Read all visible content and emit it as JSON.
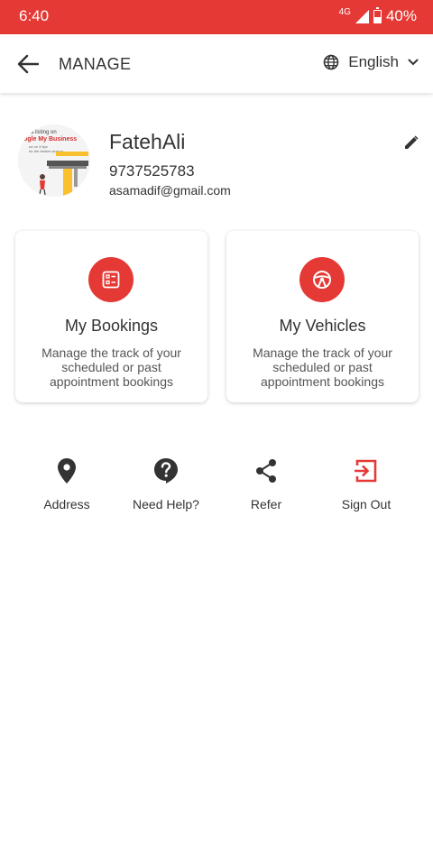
{
  "status_bar": {
    "time": "6:40",
    "network": "4G",
    "battery_percent": "40%",
    "battery_level": 0.4,
    "color": "#e53935"
  },
  "app_bar": {
    "back_icon": "arrow-left-icon",
    "title": "MANAGE",
    "language_icon": "globe-icon",
    "language": "English",
    "dropdown_icon": "chevron-down-icon"
  },
  "profile": {
    "name": "FatehAli",
    "phone": "9737525783",
    "email": "asamadif@gmail.com",
    "avatar_text": {
      "line1": "a listing on",
      "line2": "ogle My Business",
      "line3": "ue on 3 tips",
      "line4": "for the festive season"
    },
    "edit_icon": "pencil-icon"
  },
  "cards": [
    {
      "title": "My Bookings",
      "description": "Manage the track of your scheduled or past appointment bookings",
      "icon": "bookings-list-icon"
    },
    {
      "title": "My Vehicles",
      "description": "Manage the track of your scheduled or past appointment bookings",
      "icon": "steering-wheel-icon"
    }
  ],
  "actions": [
    {
      "label": "Address",
      "icon": "location-pin-icon"
    },
    {
      "label": "Need Help?",
      "icon": "help-icon"
    },
    {
      "label": "Refer",
      "icon": "share-icon"
    },
    {
      "label": "Sign Out",
      "icon": "sign-out-icon"
    }
  ],
  "colors": {
    "accent": "#e53935",
    "text": "#333333",
    "icon_dark": "#333333"
  }
}
